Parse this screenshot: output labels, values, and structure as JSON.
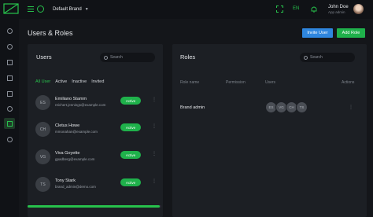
{
  "header": {
    "brand_selector": "Default Brand",
    "language": "EN",
    "user_name": "John Doe",
    "user_role": "App admin"
  },
  "page": {
    "title": "Users & Roles",
    "invite_button": "Invite User",
    "add_role_button": "Add Role"
  },
  "users_panel": {
    "title": "Users",
    "search_placeholder": "Search",
    "tabs": [
      {
        "label": "All User",
        "active": true
      },
      {
        "label": "Active",
        "active": false
      },
      {
        "label": "Inactive",
        "active": false
      },
      {
        "label": "Invited",
        "active": false
      }
    ],
    "users": [
      {
        "initials": "ES",
        "name": "Emiliano Stamm",
        "email": "reichert.jennings@example.com",
        "status": "Active"
      },
      {
        "initials": "CH",
        "name": "Cletus Howe",
        "email": "mmonahan@example.com",
        "status": "Active"
      },
      {
        "initials": "VG",
        "name": "Viva Goyette",
        "email": "gpadberg@example.com",
        "status": "Active"
      },
      {
        "initials": "TS",
        "name": "Tony Stark",
        "email": "brand_admin@demo.com",
        "status": "Active"
      }
    ]
  },
  "roles_panel": {
    "title": "Roles",
    "search_placeholder": "Search",
    "columns": [
      "Role name",
      "Permission",
      "Users",
      "Actions"
    ],
    "roles": [
      {
        "name": "Brand admin",
        "user_initials": [
          "ES",
          "VG",
          "CH",
          "TS"
        ]
      }
    ]
  },
  "colors": {
    "accent_green": "#27c24c",
    "active_badge": "#1fb14b",
    "invite_blue": "#2f86de",
    "panel_bg": "#1c1f24",
    "page_bg": "#14161a"
  },
  "icons": [
    "logo-icon",
    "hamburger-icon",
    "theme-icon",
    "fullscreen-icon",
    "bell-icon",
    "search-icon",
    "more-icon"
  ]
}
